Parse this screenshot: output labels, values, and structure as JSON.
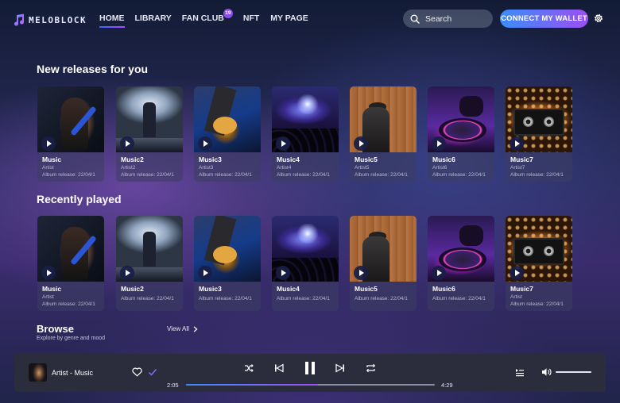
{
  "header": {
    "logo_text": "MELOBLOCK",
    "nav": [
      {
        "label": "HOME",
        "active": true
      },
      {
        "label": "LIBRARY",
        "active": false
      },
      {
        "label": "FAN CLUB",
        "active": false,
        "badge": "19"
      },
      {
        "label": "NFT",
        "active": false
      },
      {
        "label": "MY PAGE",
        "active": false
      }
    ],
    "search_label": "Search",
    "connect_label": "CONNECT MY WALLET"
  },
  "new_releases": {
    "title": "New releases for you",
    "items": [
      {
        "title": "Music",
        "artist": "Artist",
        "release": "Album release: 22/04/1"
      },
      {
        "title": "Music2",
        "artist": "Artist2",
        "release": "Album release: 22/04/1"
      },
      {
        "title": "Music3",
        "artist": "Artist3",
        "release": "Album release: 22/04/1"
      },
      {
        "title": "Music4",
        "artist": "Artist4",
        "release": "Album release: 22/04/1"
      },
      {
        "title": "Music5",
        "artist": "Artist5",
        "release": "Album release: 22/04/1"
      },
      {
        "title": "Music6",
        "artist": "Artist6",
        "release": "Album release: 22/04/1"
      },
      {
        "title": "Music7",
        "artist": "Artist7",
        "release": "Album release: 22/04/1"
      }
    ]
  },
  "recently_played": {
    "title": "Recently played",
    "items": [
      {
        "title": "Music",
        "artist": "Artist",
        "release": "Album release: 22/04/1"
      },
      {
        "title": "Music2",
        "artist": "Album release: 22/04/1",
        "release": ""
      },
      {
        "title": "Music3",
        "artist": "Album release: 22/04/1",
        "release": ""
      },
      {
        "title": "Music4",
        "artist": "Album release: 22/04/1",
        "release": ""
      },
      {
        "title": "Music5",
        "artist": "Album release: 22/04/1",
        "release": ""
      },
      {
        "title": "Music6",
        "artist": "Album release: 22/04/1",
        "release": ""
      },
      {
        "title": "Music7",
        "artist": "Artist",
        "release": "Album release: 22/04/1"
      }
    ]
  },
  "browse": {
    "title": "Browse",
    "subtitle": "Explore by genre and mood",
    "view_all": "View All"
  },
  "player": {
    "track": "Artist - Music",
    "current_time": "2:05",
    "total_time": "4:29",
    "progress_percent": 53,
    "volume_percent": 100,
    "liked": false,
    "added": true
  },
  "colors": {
    "accent_blue": "#3a8dfa",
    "accent_purple": "#9b4ff0",
    "player_bg": "#2b2d3d"
  }
}
